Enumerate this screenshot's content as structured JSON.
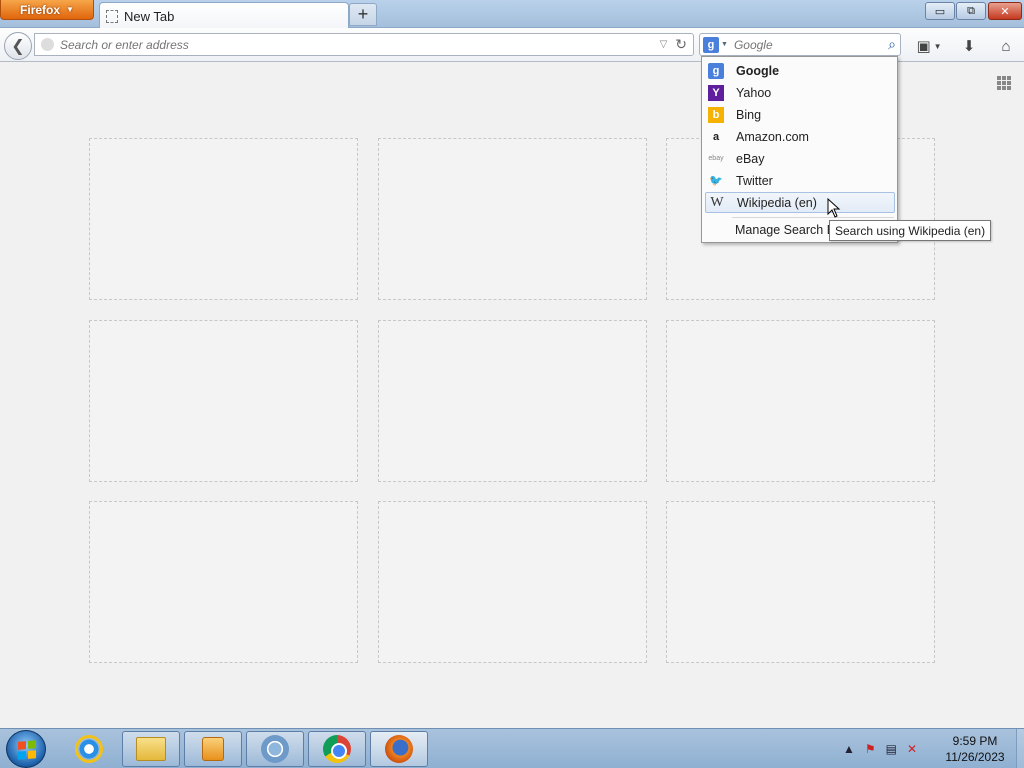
{
  "browser": {
    "app_menu_label": "Firefox",
    "tab_title": "New Tab",
    "new_tab_symbol": "+",
    "window_controls": {
      "minimize": "▭",
      "maximize": "⧉",
      "close": "✕"
    }
  },
  "navbar": {
    "back_icon": "back-arrow-icon",
    "url_placeholder": "Search or enter address",
    "url_value": "",
    "search_placeholder": "Google",
    "search_value": "",
    "current_engine_glyph": "g"
  },
  "search_menu": {
    "engines": [
      {
        "label": "Google",
        "glyph": "g",
        "color": "#4a7fdc",
        "bold": true
      },
      {
        "label": "Yahoo",
        "glyph": "Y",
        "color": "#5f1e9e",
        "bold": false
      },
      {
        "label": "Bing",
        "glyph": "b",
        "color": "#f6b200",
        "bold": false
      },
      {
        "label": "Amazon.com",
        "glyph": "a",
        "color": "#222222",
        "bold": false
      },
      {
        "label": "eBay",
        "glyph": "ebay",
        "color": "#888888",
        "bold": false
      },
      {
        "label": "Twitter",
        "glyph": "🐦",
        "color": "#2aa9e0",
        "bold": false
      },
      {
        "label": "Wikipedia (en)",
        "glyph": "W",
        "color": "#333333",
        "bold": false
      }
    ],
    "manage_label": "Manage Search Engines...",
    "hovered_engine": "Wikipedia (en)"
  },
  "tooltip": "Search using Wikipedia (en)",
  "new_tab_page": {
    "tile_count": 9
  },
  "taskbar": {
    "time": "9:59 PM",
    "date": "11/26/2023",
    "apps": [
      "internet-explorer",
      "file-explorer",
      "media-player",
      "chromium",
      "chrome",
      "firefox"
    ]
  },
  "colors": {
    "firefox_button": "#e8750f",
    "taskbar": "#9cb9d8",
    "page_background": "#f1f1f1"
  }
}
